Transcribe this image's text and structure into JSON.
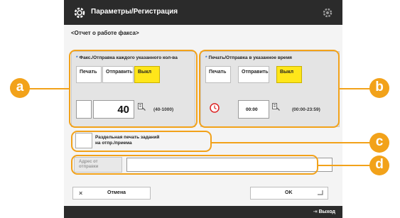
{
  "header": {
    "title": "Параметры/Регистрация"
  },
  "subtitle": "<Отчет о работе факса>",
  "group_a": {
    "title": "Факс./Отправка каждого указанного кол-ва",
    "buttons": [
      "Печать",
      "Отправить",
      "Выкл"
    ],
    "selected": "Выкл",
    "value": "40",
    "range": "(40-1000)"
  },
  "group_b": {
    "title": "Печать/Отправка в указанное время",
    "buttons": [
      "Печать",
      "Отправить",
      "Выкл"
    ],
    "selected": "Выкл",
    "time": "00:00",
    "range": "(00:00-23:59)"
  },
  "separate": {
    "label_line1": "Раздельная печать заданий",
    "label_line2": "на отпр./приема"
  },
  "address": {
    "button_line1": "Адрес от",
    "button_line2": "отправки"
  },
  "footer": {
    "cancel": "Отмена",
    "ok": "OK",
    "status": "Выход"
  },
  "callouts": [
    "a",
    "b",
    "c",
    "d"
  ],
  "colors": {
    "accent": "#f2a21a",
    "selected": "#ffe61a",
    "titlebar": "#2b2b2b"
  },
  "icons": [
    "gear-icon",
    "settings-icon",
    "keypad-icon",
    "clock-icon",
    "close-icon",
    "enter-icon",
    "logout-icon"
  ]
}
